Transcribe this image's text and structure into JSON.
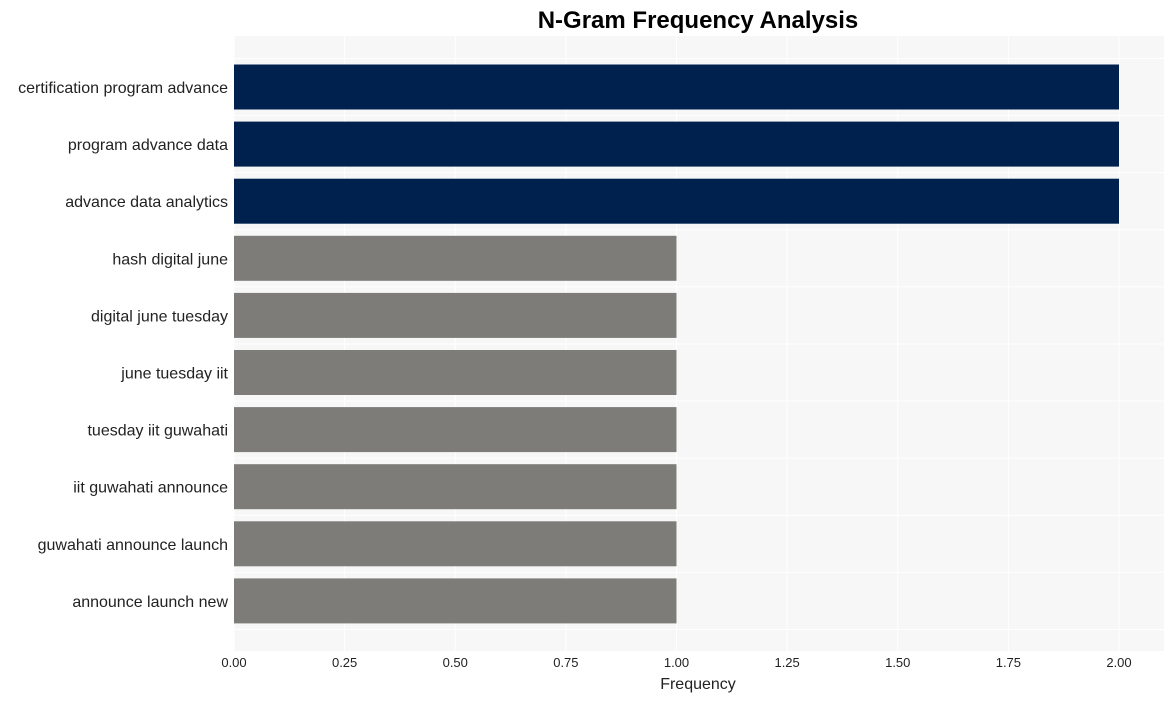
{
  "chart_data": {
    "type": "bar",
    "orientation": "horizontal",
    "title": "N-Gram Frequency Analysis",
    "xlabel": "Frequency",
    "ylabel": "",
    "xlim": [
      0,
      2.1
    ],
    "xticks": [
      0.0,
      0.25,
      0.5,
      0.75,
      1.0,
      1.25,
      1.5,
      1.75,
      2.0
    ],
    "xtick_labels": [
      "0.00",
      "0.25",
      "0.50",
      "0.75",
      "1.00",
      "1.25",
      "1.50",
      "1.75",
      "2.00"
    ],
    "grid": true,
    "categories": [
      "certification program advance",
      "program advance data",
      "advance data analytics",
      "hash digital june",
      "digital june tuesday",
      "june tuesday iit",
      "tuesday iit guwahati",
      "iit guwahati announce",
      "guwahati announce launch",
      "announce launch new"
    ],
    "values": [
      2,
      2,
      2,
      1,
      1,
      1,
      1,
      1,
      1,
      1
    ],
    "colors": {
      "high": "#00214e",
      "low": "#7d7c78",
      "plot_background": "#f7f7f7",
      "grid": "#ffffff"
    }
  }
}
